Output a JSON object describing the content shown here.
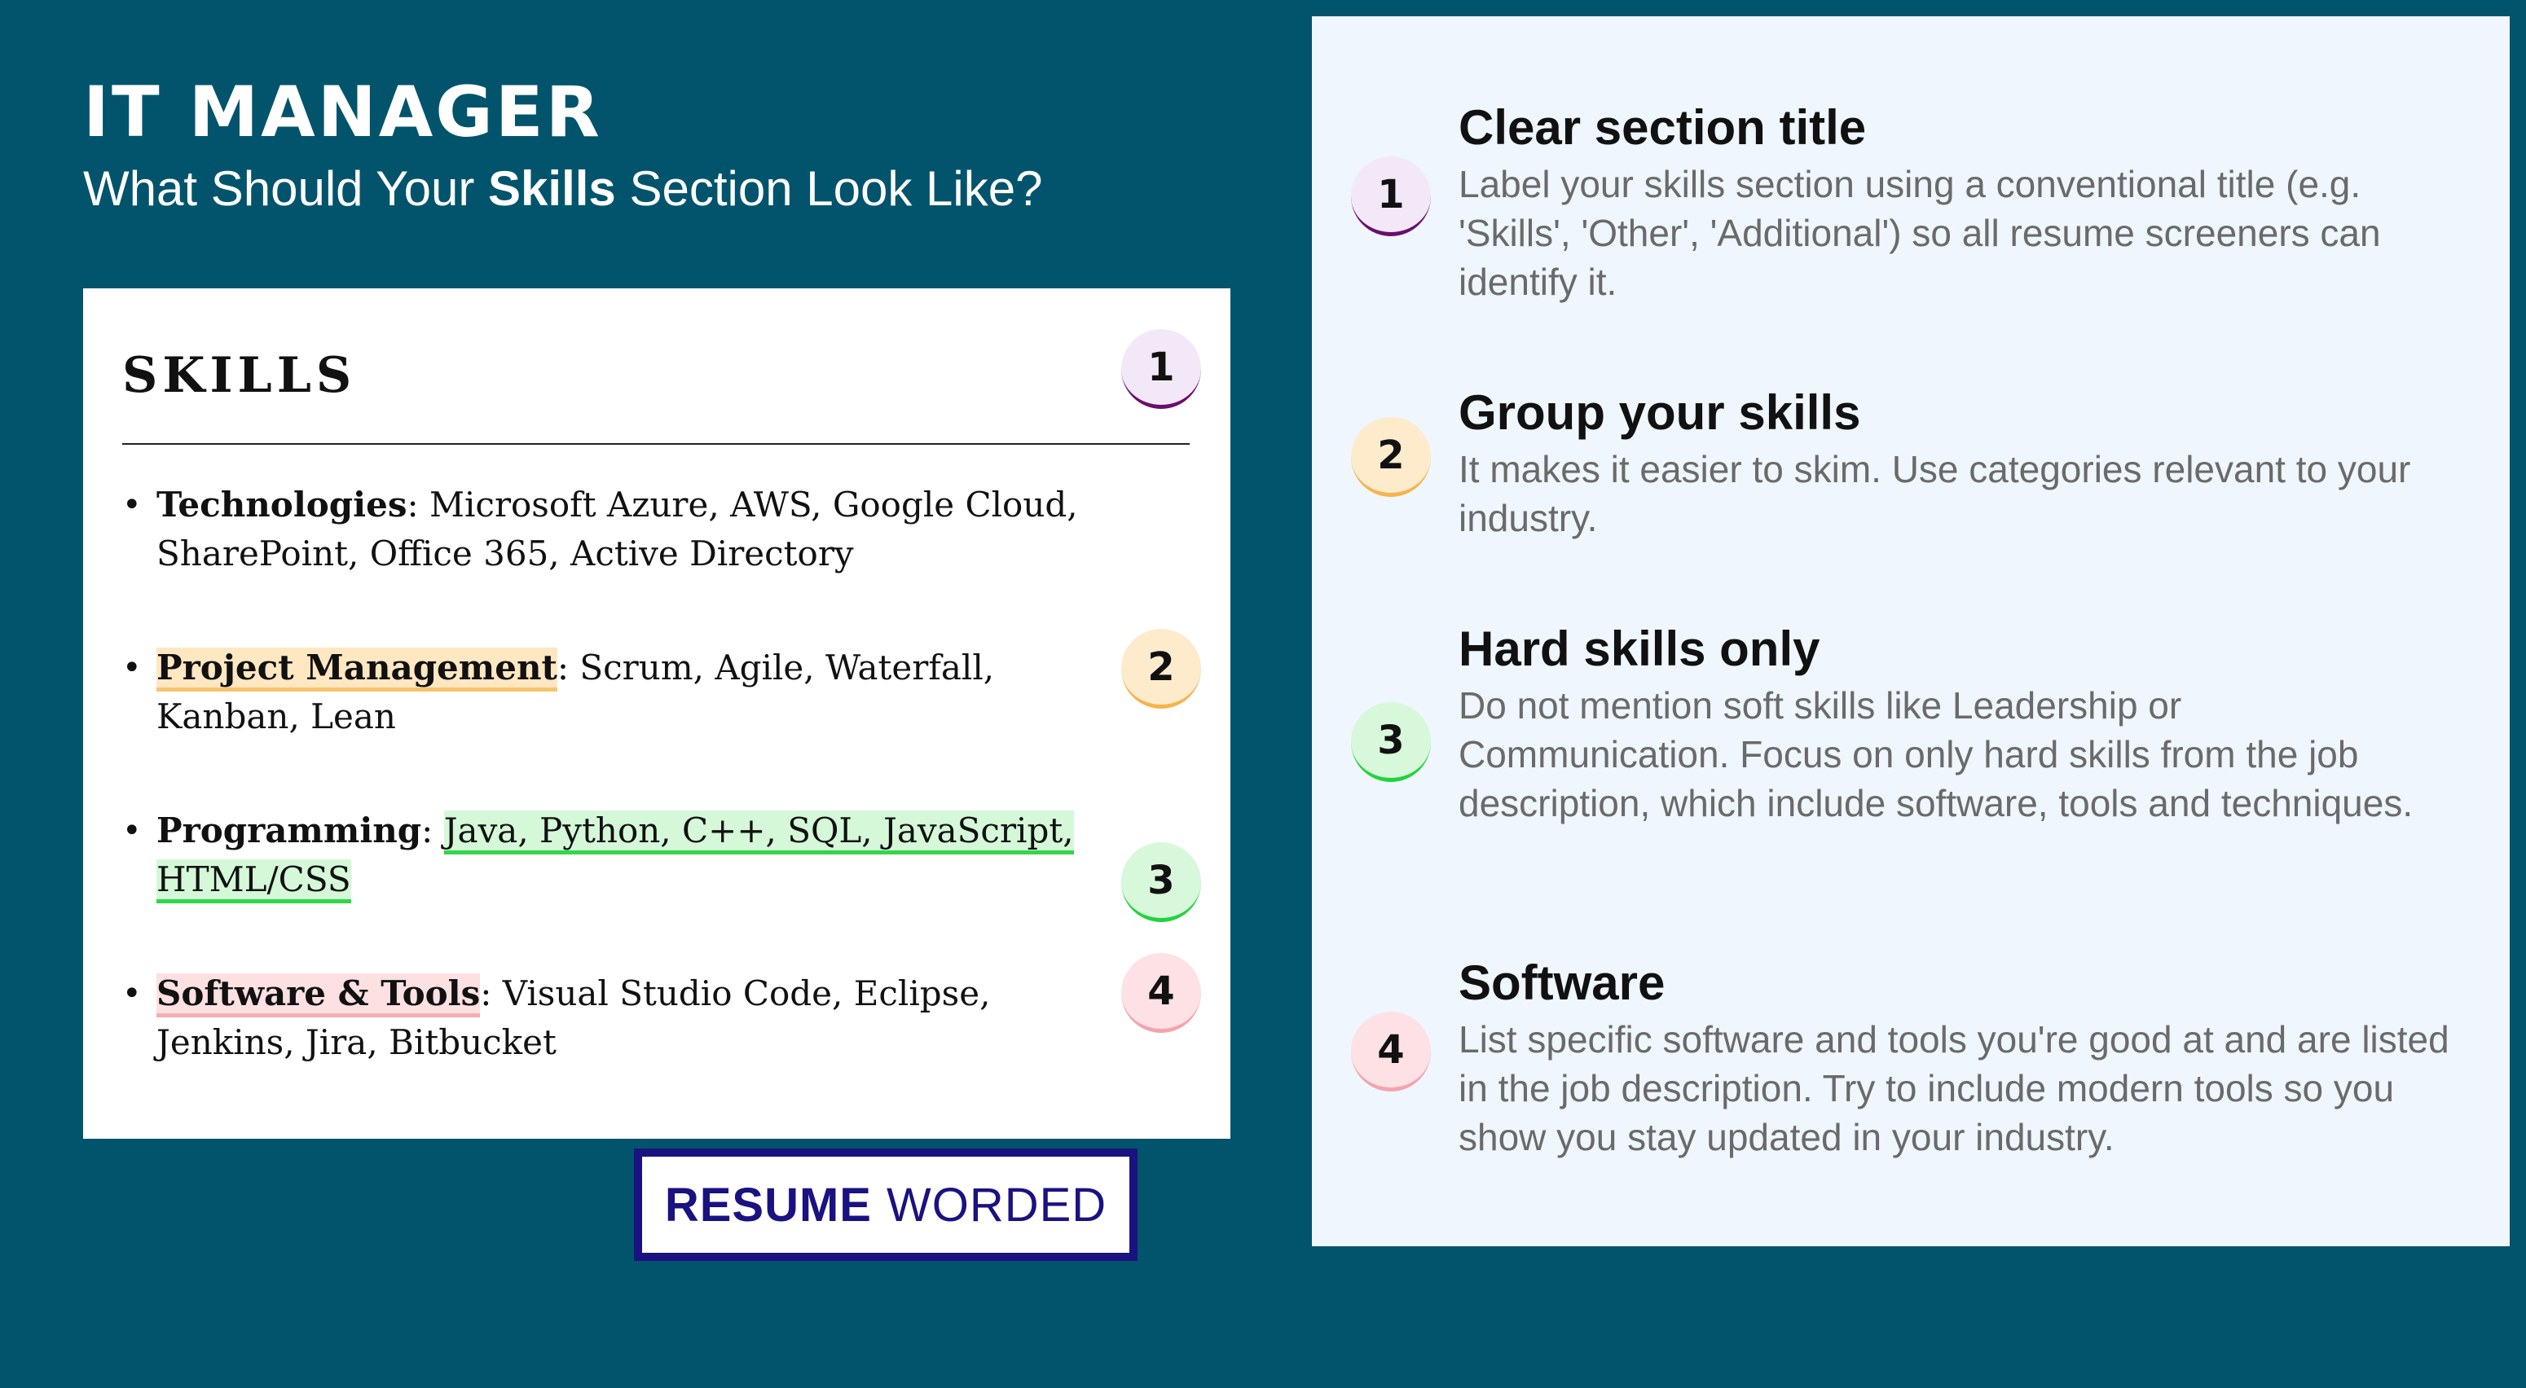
{
  "header": {
    "title": "IT MANAGER",
    "subtitle_before": "What Should Your ",
    "subtitle_bold": "Skills",
    "subtitle_after": " Section Look Like?"
  },
  "resume": {
    "heading": "SKILLS",
    "items": [
      {
        "label": "Technologies",
        "text": ": Microsoft Azure, AWS, Google Cloud, SharePoint, Office 365, Active Directory"
      },
      {
        "label": "Project Management",
        "text": ": Scrum, Agile, Waterfall, Kanban, Lean"
      },
      {
        "label": "Programming",
        "sep": ": ",
        "text": "Java, Python, C++, SQL, JavaScript, HTML/CSS"
      },
      {
        "label": "Software & Tools",
        "text": ": Visual Studio Code, Eclipse, Jenkins, Jira, Bitbucket"
      }
    ]
  },
  "badges": [
    "1",
    "2",
    "3",
    "4"
  ],
  "logo": {
    "bold": "RESUME",
    "light": "WORDED"
  },
  "tips": [
    {
      "title": "Clear section title",
      "desc": "Label your skills section using a conventional title (e.g. 'Skills', 'Other', 'Additional') so all resume screeners can identify it."
    },
    {
      "title": "Group your skills",
      "desc": "It makes it easier to skim. Use categories relevant to your industry."
    },
    {
      "title": "Hard skills only",
      "desc": "Do not mention soft skills like Leadership or Communication. Focus on only hard skills from the job description, which include software, tools and techniques."
    },
    {
      "title": "Software",
      "desc": "List specific software and tools you're good at and are listed in the job description. Try to include modern tools so you show you stay updated in your industry."
    }
  ],
  "colors": {
    "background": "#02546c",
    "badge1": "#6b0f6b",
    "badge2": "#f5b44c",
    "badge3": "#24d23f",
    "badge4": "#f5a3ad",
    "logo": "#1a1280"
  }
}
